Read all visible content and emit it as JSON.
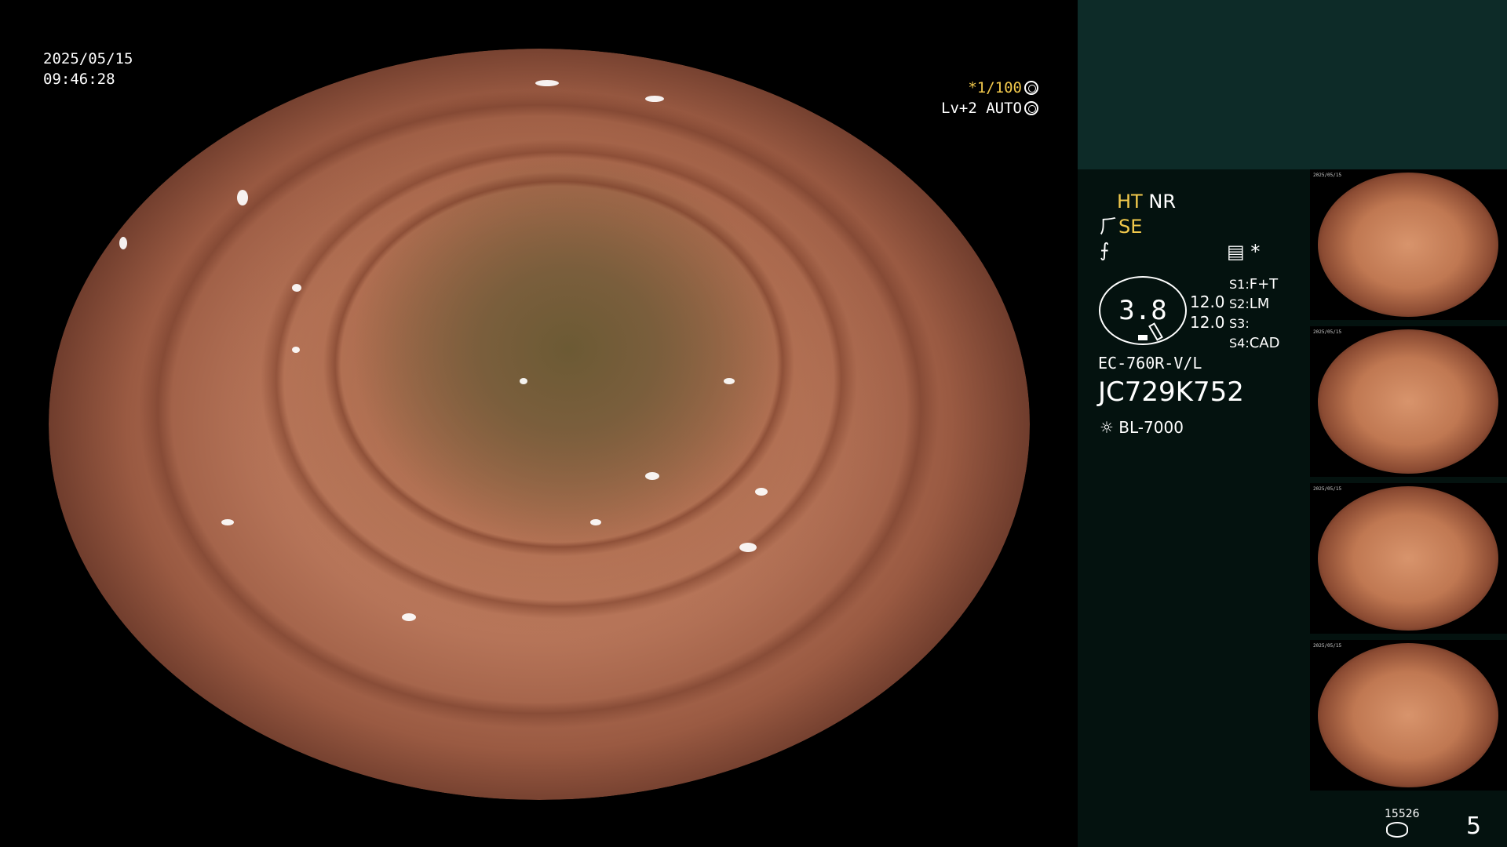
{
  "overlay": {
    "date": "2025/05/15",
    "time": "09:46:28",
    "shutter": "*1/100",
    "level": "Lv+2 AUTO"
  },
  "panel": {
    "ht": "HT",
    "nr": "NR",
    "se": "SE",
    "gauge_value": "3.8",
    "side_values": [
      "12.0",
      "12.0"
    ],
    "switches": [
      {
        "key": "S1:",
        "value": "F+T"
      },
      {
        "key": "S2:",
        "value": "LM"
      },
      {
        "key": "S3:",
        "value": ""
      },
      {
        "key": "S4:",
        "value": "CAD"
      }
    ],
    "asterisk": "*",
    "scope_model": "EC-760R-V/L",
    "serial": "JC729K752",
    "light_source": "BL-7000"
  },
  "footer": {
    "image_count": "15526",
    "page_number": "5"
  },
  "thumbnails": [
    {
      "caption": "2025/05/15"
    },
    {
      "caption": "2025/05/15"
    },
    {
      "caption": "2025/05/15"
    },
    {
      "caption": "2025/05/15"
    }
  ]
}
